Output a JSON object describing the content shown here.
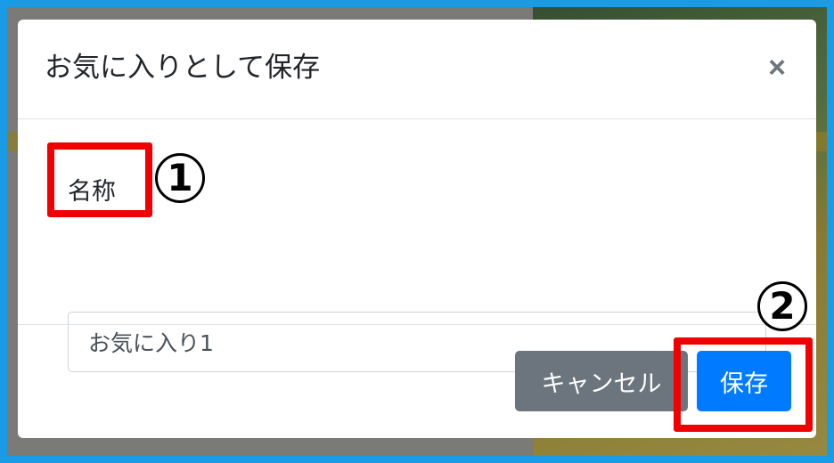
{
  "dialog": {
    "title": "お気に入りとして保存",
    "close_symbol": "×",
    "name_label": "名称",
    "name_input_value": "お気に入り1",
    "cancel_label": "キャンセル",
    "save_label": "保存"
  },
  "annotations": {
    "marker_1": "1",
    "marker_2": "2",
    "highlight_color": "#f00000"
  },
  "colors": {
    "primary": "#007bff",
    "secondary": "#6c757d",
    "page_border": "#1a9be6"
  }
}
